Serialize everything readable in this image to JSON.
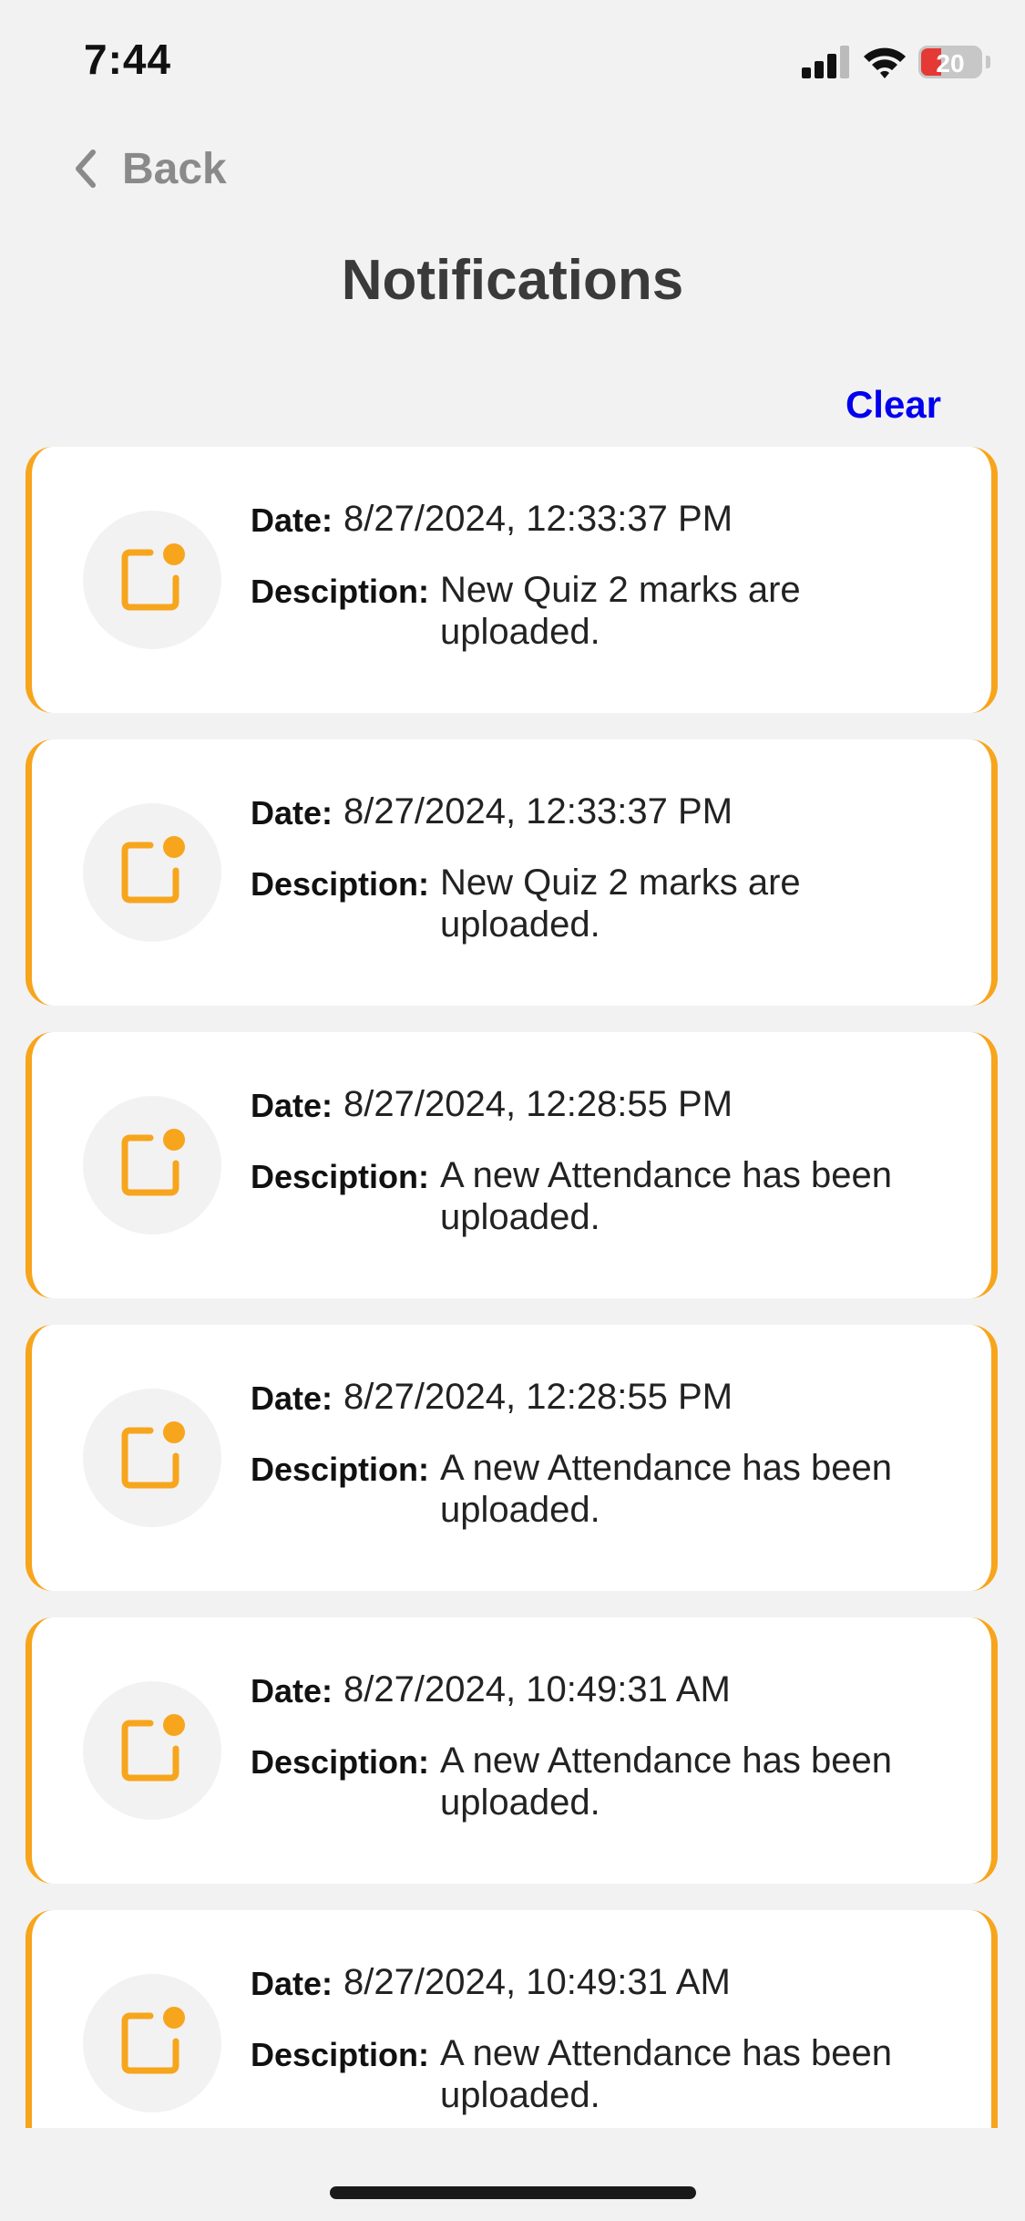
{
  "status_bar": {
    "time": "7:44",
    "battery_percent": "20"
  },
  "nav": {
    "back_label": "Back"
  },
  "page": {
    "title": "Notifications",
    "clear_label": "Clear"
  },
  "labels": {
    "date": "Date:",
    "description": "Desciption:"
  },
  "colors": {
    "accent": "#f7a51c",
    "link": "#0000ee",
    "background": "#f2f2f2"
  },
  "notifications": [
    {
      "date": "8/27/2024, 12:33:37 PM",
      "description": "New Quiz 2 marks are uploaded.",
      "icon": "notification-icon"
    },
    {
      "date": "8/27/2024, 12:33:37 PM",
      "description": "New Quiz 2 marks are uploaded.",
      "icon": "notification-icon"
    },
    {
      "date": "8/27/2024, 12:28:55 PM",
      "description": "A new Attendance has been uploaded.",
      "icon": "notification-icon"
    },
    {
      "date": "8/27/2024, 12:28:55 PM",
      "description": "A new Attendance has been uploaded.",
      "icon": "notification-icon"
    },
    {
      "date": "8/27/2024, 10:49:31 AM",
      "description": "A new Attendance has been uploaded.",
      "icon": "notification-icon"
    },
    {
      "date": "8/27/2024, 10:49:31 AM",
      "description": "A new Attendance has been uploaded.",
      "icon": "notification-icon"
    }
  ]
}
